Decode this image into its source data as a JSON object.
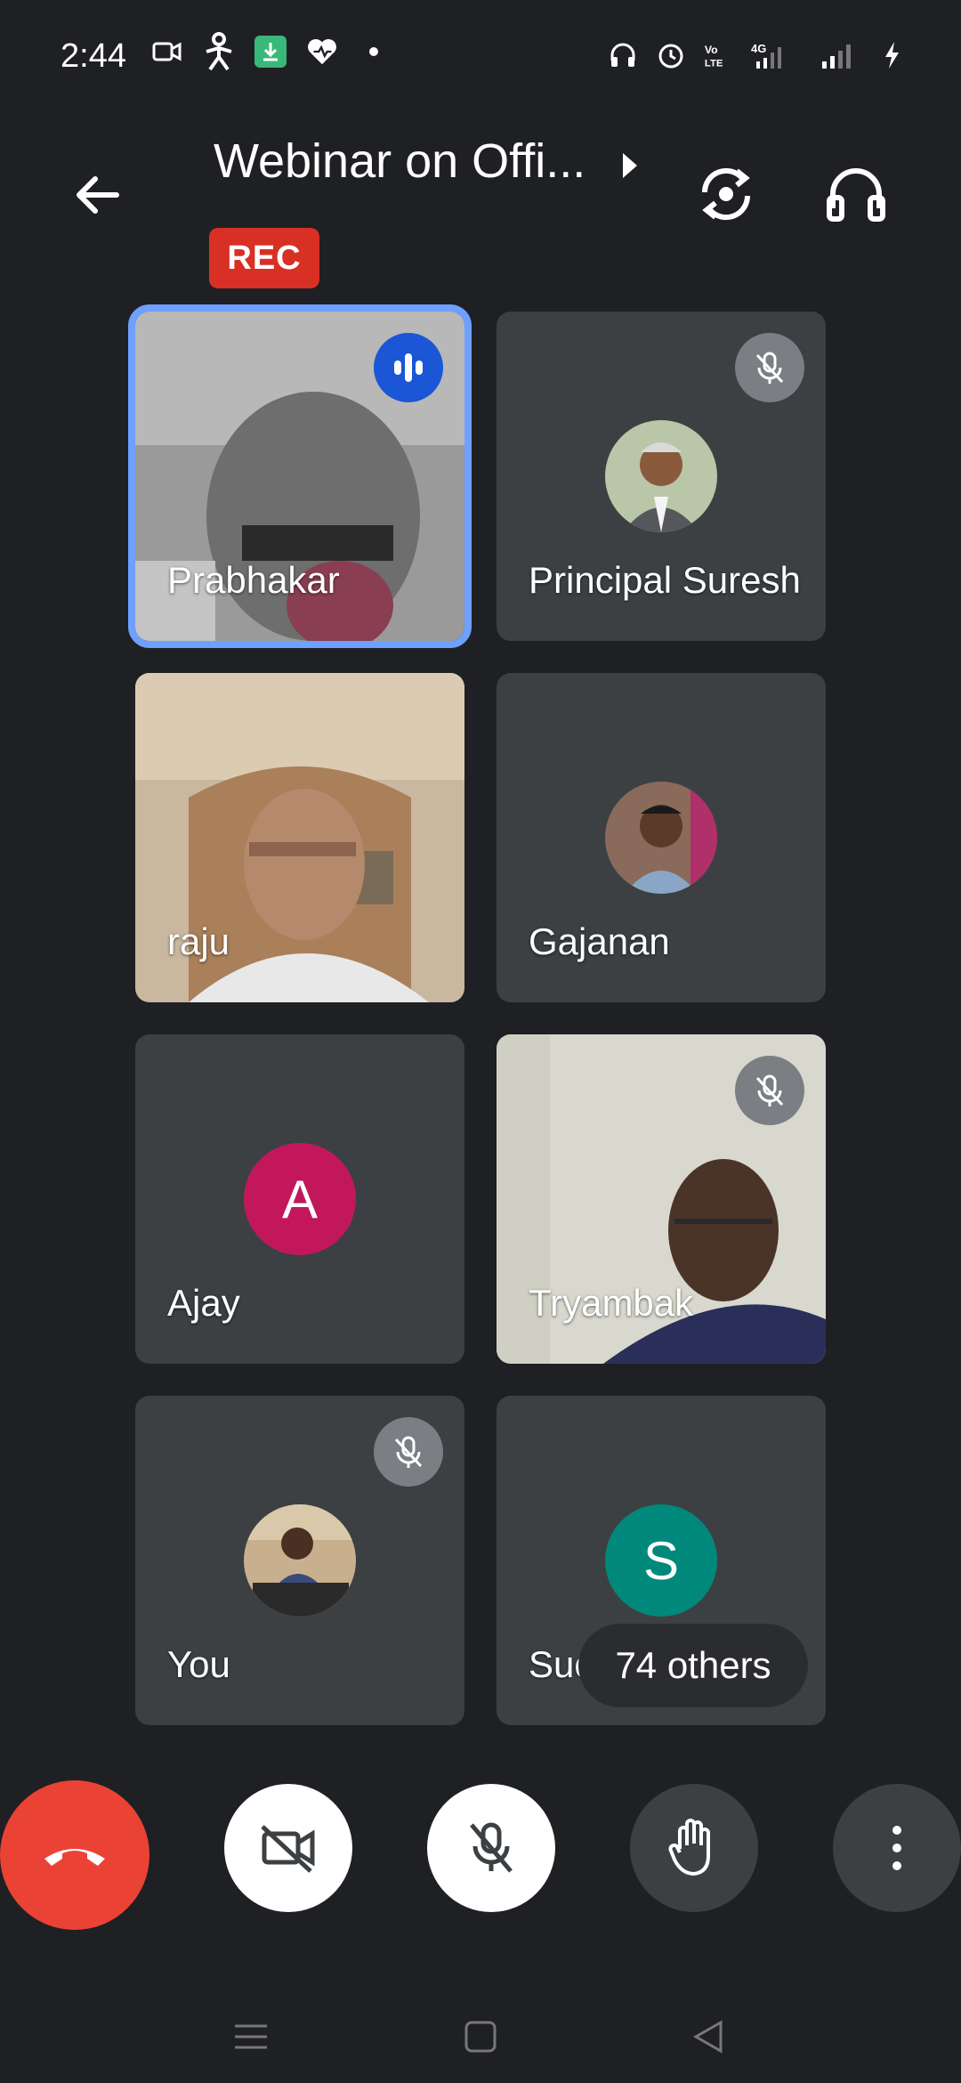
{
  "status_bar": {
    "time": "2:44",
    "network": "4G"
  },
  "header": {
    "title": "Webinar on Offi...",
    "rec_label": "REC"
  },
  "participants": [
    {
      "name": "Prabhakar",
      "state": "speaking"
    },
    {
      "name": "Principal Suresh",
      "state": "muted"
    },
    {
      "name": "raju",
      "state": "video"
    },
    {
      "name": "Gajanan",
      "state": "avatar"
    },
    {
      "name": "Ajay",
      "state": "avatar",
      "initial": "A",
      "color": "#c2185b"
    },
    {
      "name": "Tryambak",
      "state": "muted"
    },
    {
      "name": "You",
      "state": "muted"
    },
    {
      "name": "Suchitra",
      "state": "avatar",
      "initial": "S",
      "color": "#00897b"
    }
  ],
  "others_label": "74 others",
  "colors": {
    "background": "#1f2023",
    "tile": "#3c4043",
    "end_call": "#ea4335",
    "active_outline": "#6ea0ff",
    "rec": "#d93025"
  }
}
